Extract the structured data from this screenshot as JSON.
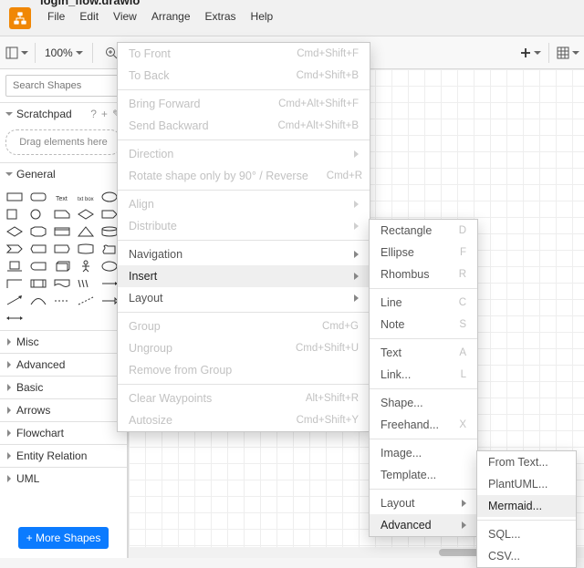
{
  "filename": "login_flow.drawio",
  "menubar": [
    "File",
    "Edit",
    "View",
    "Arrange",
    "Extras",
    "Help"
  ],
  "toolbar": {
    "zoom": "100%"
  },
  "sidebar": {
    "search_placeholder": "Search Shapes",
    "scratchpad": {
      "title": "Scratchpad",
      "dropzone": "Drag elements here"
    },
    "general_title": "General",
    "collapsed_sections": [
      "Misc",
      "Advanced",
      "Basic",
      "Arrows",
      "Flowchart",
      "Entity Relation",
      "UML"
    ],
    "more_shapes": "+ More Shapes"
  },
  "arrange_menu": [
    {
      "label": "To Front",
      "shortcut": "Cmd+Shift+F",
      "disabled": true
    },
    {
      "label": "To Back",
      "shortcut": "Cmd+Shift+B",
      "disabled": true
    },
    {
      "sep": true
    },
    {
      "label": "Bring Forward",
      "shortcut": "Cmd+Alt+Shift+F",
      "disabled": true
    },
    {
      "label": "Send Backward",
      "shortcut": "Cmd+Alt+Shift+B",
      "disabled": true
    },
    {
      "sep": true
    },
    {
      "label": "Direction",
      "submenu": true,
      "disabled": true
    },
    {
      "label": "Rotate shape only by 90° / Reverse",
      "shortcut": "Cmd+R",
      "disabled": true
    },
    {
      "sep": true
    },
    {
      "label": "Align",
      "submenu": true,
      "disabled": true
    },
    {
      "label": "Distribute",
      "submenu": true,
      "disabled": true
    },
    {
      "sep": true
    },
    {
      "label": "Navigation",
      "submenu": true
    },
    {
      "label": "Insert",
      "submenu": true,
      "highlight": true
    },
    {
      "label": "Layout",
      "submenu": true
    },
    {
      "sep": true
    },
    {
      "label": "Group",
      "shortcut": "Cmd+G",
      "disabled": true
    },
    {
      "label": "Ungroup",
      "shortcut": "Cmd+Shift+U",
      "disabled": true
    },
    {
      "label": "Remove from Group",
      "disabled": true
    },
    {
      "sep": true
    },
    {
      "label": "Clear Waypoints",
      "shortcut": "Alt+Shift+R",
      "disabled": true
    },
    {
      "label": "Autosize",
      "shortcut": "Cmd+Shift+Y",
      "disabled": true
    }
  ],
  "insert_menu": [
    {
      "label": "Rectangle",
      "shortcut": "D"
    },
    {
      "label": "Ellipse",
      "shortcut": "F"
    },
    {
      "label": "Rhombus",
      "shortcut": "R"
    },
    {
      "sep": true
    },
    {
      "label": "Line",
      "shortcut": "C"
    },
    {
      "label": "Note",
      "shortcut": "S"
    },
    {
      "sep": true
    },
    {
      "label": "Text",
      "shortcut": "A"
    },
    {
      "label": "Link...",
      "shortcut": "L"
    },
    {
      "sep": true
    },
    {
      "label": "Shape..."
    },
    {
      "label": "Freehand...",
      "shortcut": "X"
    },
    {
      "sep": true
    },
    {
      "label": "Image..."
    },
    {
      "label": "Template..."
    },
    {
      "sep": true
    },
    {
      "label": "Layout",
      "submenu": true
    },
    {
      "label": "Advanced",
      "submenu": true,
      "highlight": true
    }
  ],
  "advanced_menu": [
    {
      "label": "From Text..."
    },
    {
      "label": "PlantUML..."
    },
    {
      "label": "Mermaid...",
      "highlight": true
    },
    {
      "sep": true
    },
    {
      "label": "SQL..."
    },
    {
      "label": "CSV..."
    }
  ]
}
